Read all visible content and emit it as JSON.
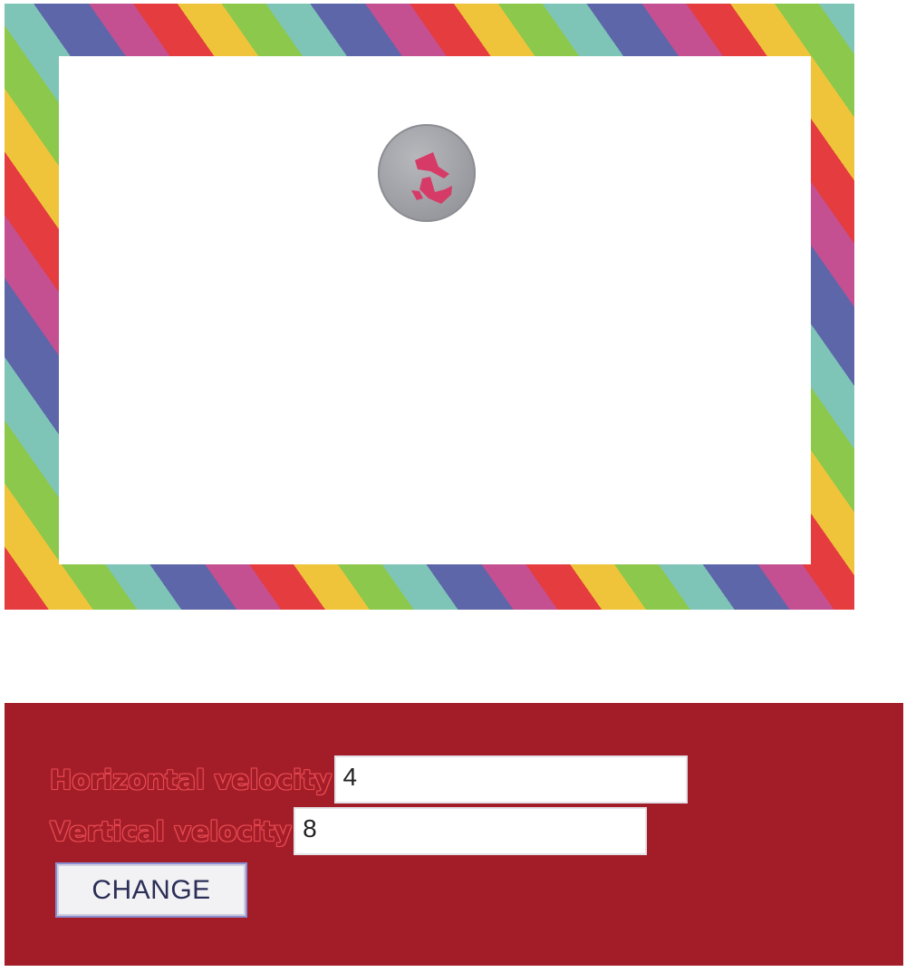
{
  "controls": {
    "horizontal_label": "Horizontal velocity",
    "horizontal_value": "4",
    "vertical_label": "Vertical velocity",
    "vertical_value": "8",
    "button_label": "CHANGE"
  },
  "colors": {
    "panel_background": "#a21d27",
    "frame_red": "#e43c3f",
    "frame_yellow": "#f0c43a",
    "frame_green": "#8cc84c",
    "frame_cyan": "#7ec5b7",
    "frame_blue": "#5d66a9",
    "frame_magenta": "#c45091",
    "ball_gray": "#a3a4a8",
    "ball_pink": "#d63b68"
  },
  "icons": {
    "ball": "gray-ball-icon",
    "ball_mark": "pink-shape-icon"
  }
}
